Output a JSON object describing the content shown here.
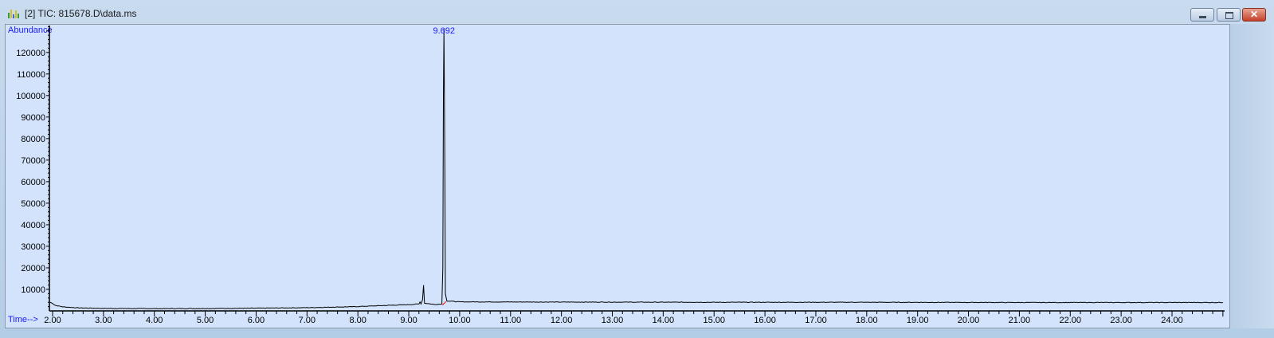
{
  "window": {
    "title": "[2] TIC: 815678.D\\data.ms",
    "buttons": {
      "minimize": "minimize",
      "maximize": "maximize",
      "close": "✕"
    }
  },
  "chart_data": {
    "type": "line",
    "title": "",
    "ylabel": "Abundance",
    "xlabel": "Time-->",
    "xlim": [
      1.92,
      25.05
    ],
    "ylim": [
      0,
      132500
    ],
    "grid": false,
    "x_ticks": [
      "2.00",
      "3.00",
      "4.00",
      "5.00",
      "6.00",
      "7.00",
      "8.00",
      "9.00",
      "10.00",
      "11.00",
      "12.00",
      "13.00",
      "14.00",
      "15.00",
      "16.00",
      "17.00",
      "18.00",
      "19.00",
      "20.00",
      "21.00",
      "22.00",
      "23.00",
      "24.00"
    ],
    "y_ticks": [
      "10000",
      "20000",
      "30000",
      "40000",
      "50000",
      "60000",
      "70000",
      "80000",
      "90000",
      "100000",
      "110000",
      "120000"
    ],
    "peak_labels": [
      {
        "x": 9.692,
        "label": "9.692"
      }
    ],
    "colors": {
      "background": "#d3e3fc",
      "trace": "#000000",
      "label": "#1a1aff",
      "baseline_marker": "#ff0000"
    },
    "series": [
      {
        "points": [
          [
            1.95,
            4000
          ],
          [
            2.0,
            3500
          ],
          [
            2.05,
            2600
          ],
          [
            2.2,
            1900
          ],
          [
            2.5,
            1400
          ],
          [
            3.0,
            1150
          ],
          [
            4.0,
            1050
          ],
          [
            5.0,
            1100
          ],
          [
            6.0,
            1250
          ],
          [
            7.0,
            1500
          ],
          [
            8.0,
            2000
          ],
          [
            8.5,
            2500
          ],
          [
            9.0,
            2900
          ],
          [
            9.2,
            3200
          ],
          [
            9.22,
            4300
          ],
          [
            9.24,
            3200
          ],
          [
            9.27,
            5200
          ],
          [
            9.29,
            12000
          ],
          [
            9.31,
            3600
          ],
          [
            9.5,
            3000
          ],
          [
            9.65,
            3200
          ],
          [
            9.67,
            20000
          ],
          [
            9.68,
            99000
          ],
          [
            9.692,
            131000
          ],
          [
            9.7,
            99000
          ],
          [
            9.71,
            61000
          ],
          [
            9.72,
            8000
          ],
          [
            9.75,
            4600
          ],
          [
            10.0,
            4200
          ],
          [
            12.0,
            4100
          ],
          [
            15.0,
            4000
          ],
          [
            18.0,
            4000
          ],
          [
            21.0,
            3900
          ],
          [
            25.0,
            3900
          ]
        ]
      }
    ]
  }
}
